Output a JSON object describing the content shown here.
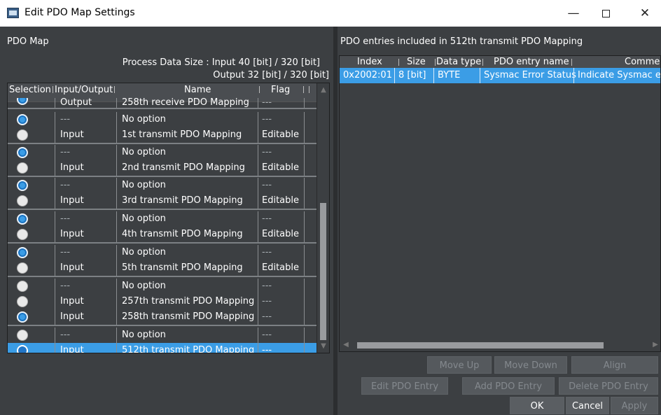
{
  "window": {
    "title": "Edit PDO Map Settings",
    "min_glyph": "—",
    "close_glyph": "✕"
  },
  "left": {
    "section_title": "PDO Map",
    "size_input": "Process Data Size : Input  40 [bit]  /  320 [bit]",
    "size_output": "Output  32 [bit]  /  320 [bit]",
    "headers": {
      "selection": "Selection",
      "io": "Input/Output",
      "name": "Name",
      "flag": "Flag"
    },
    "rows": [
      {
        "io": "Output",
        "name": "258th receive PDO Mapping",
        "flag": "---",
        "radio": "on",
        "partial": true
      },
      {
        "io": "---",
        "name": "No option",
        "flag": "---",
        "radio": "on"
      },
      {
        "io": "Input",
        "name": "1st transmit PDO Mapping",
        "flag": "Editable",
        "radio": "off"
      },
      {
        "io": "---",
        "name": "No option",
        "flag": "---",
        "radio": "on"
      },
      {
        "io": "Input",
        "name": "2nd transmit PDO Mapping",
        "flag": "Editable",
        "radio": "off"
      },
      {
        "io": "---",
        "name": "No option",
        "flag": "---",
        "radio": "on"
      },
      {
        "io": "Input",
        "name": "3rd transmit PDO Mapping",
        "flag": "Editable",
        "radio": "off"
      },
      {
        "io": "---",
        "name": "No option",
        "flag": "---",
        "radio": "on"
      },
      {
        "io": "Input",
        "name": "4th transmit PDO Mapping",
        "flag": "Editable",
        "radio": "off"
      },
      {
        "io": "---",
        "name": "No option",
        "flag": "---",
        "radio": "on"
      },
      {
        "io": "Input",
        "name": "5th transmit PDO Mapping",
        "flag": "Editable",
        "radio": "off"
      },
      {
        "io": "---",
        "name": "No option",
        "flag": "---",
        "radio": "off"
      },
      {
        "io": "Input",
        "name": "257th transmit PDO Mapping",
        "flag": "---",
        "radio": "off"
      },
      {
        "io": "Input",
        "name": "258th transmit PDO Mapping",
        "flag": "---",
        "radio": "on"
      },
      {
        "io": "---",
        "name": "No option",
        "flag": "---",
        "radio": "off"
      },
      {
        "io": "Input",
        "name": "512th transmit PDO Mapping",
        "flag": "---",
        "radio": "on",
        "selected": true
      }
    ]
  },
  "right": {
    "section_title": "PDO entries included in 512th transmit PDO Mapping",
    "headers": {
      "index": "Index",
      "size": "Size",
      "data_type": "Data type",
      "entry_name": "PDO entry name",
      "comment": "Commen"
    },
    "entry": {
      "index": "0x2002:01",
      "size": "8 [bit]",
      "data_type": "BYTE",
      "entry_name": "Sysmac Error Status",
      "comment": "Indicate Sysmac e"
    }
  },
  "buttons": {
    "move_up": "Move Up",
    "move_down": "Move Down",
    "align": "Align",
    "edit_entry": "Edit PDO Entry",
    "add_entry": "Add PDO Entry",
    "delete_entry": "Delete PDO Entry",
    "ok": "OK",
    "cancel": "Cancel",
    "apply": "Apply"
  },
  "colors": {
    "panel_bg": "#3c3f42",
    "selection_blue": "#3b9de6"
  }
}
